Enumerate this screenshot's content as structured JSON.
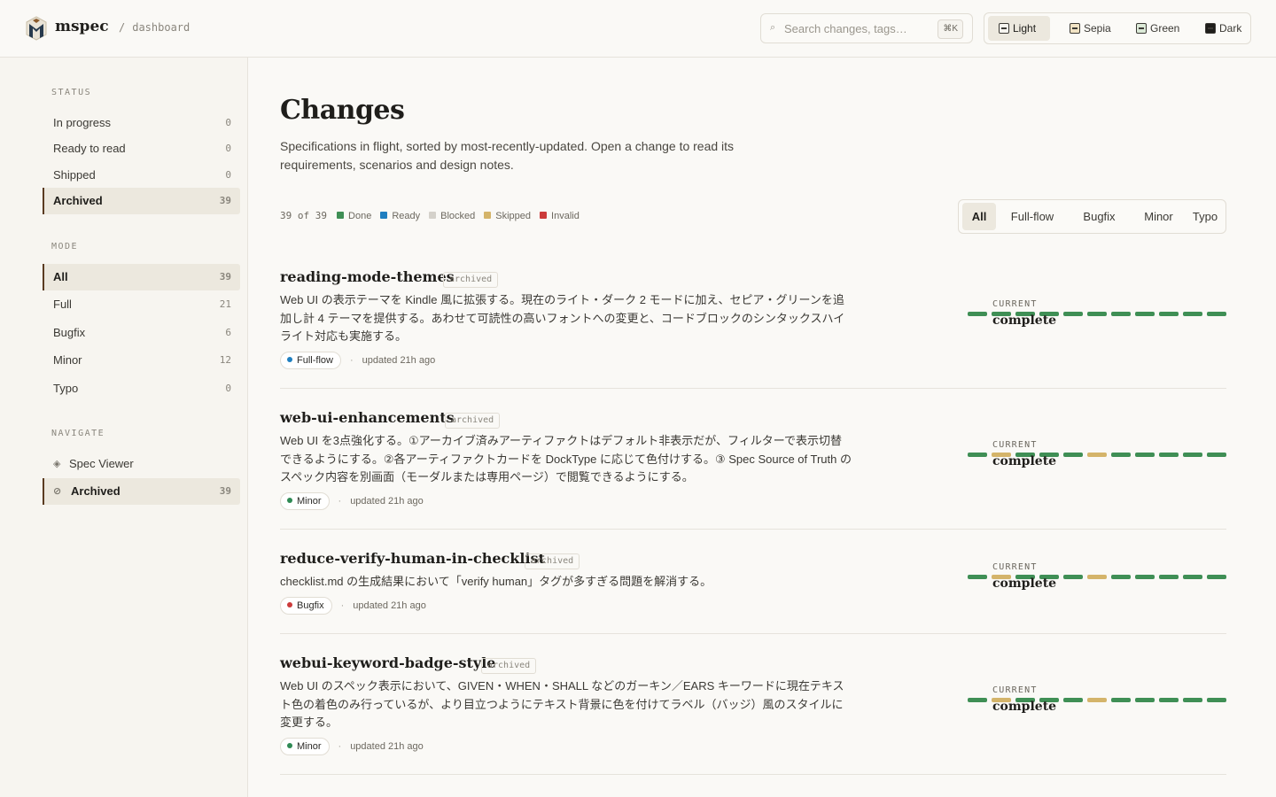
{
  "header": {
    "brand": "mspec",
    "crumb_sep": "/",
    "crumb": "dashboard",
    "search_placeholder": "Search changes, tags…",
    "search_shortcut": "⌘K",
    "themes": [
      {
        "label": "Light",
        "swatch": "#f6f4ef",
        "active": true
      },
      {
        "label": "Sepia",
        "swatch": "#f1e3c4",
        "active": false
      },
      {
        "label": "Green",
        "swatch": "#dbe9d7",
        "active": false
      },
      {
        "label": "Dark",
        "swatch": "#1f1e1b",
        "active": false
      }
    ]
  },
  "sidebar": {
    "status_title": "STATUS",
    "status": [
      {
        "label": "In progress",
        "count": "0",
        "active": false
      },
      {
        "label": "Ready to read",
        "count": "0",
        "active": false
      },
      {
        "label": "Shipped",
        "count": "0",
        "active": false
      },
      {
        "label": "Archived",
        "count": "39",
        "active": true
      }
    ],
    "mode_title": "MODE",
    "mode": [
      {
        "label": "All",
        "count": "39",
        "active": true
      },
      {
        "label": "Full",
        "count": "21",
        "active": false
      },
      {
        "label": "Bugfix",
        "count": "6",
        "active": false
      },
      {
        "label": "Minor",
        "count": "12",
        "active": false
      },
      {
        "label": "Typo",
        "count": "0",
        "active": false
      }
    ],
    "navigate_title": "NAVIGATE",
    "navigate": [
      {
        "label": "Spec Viewer",
        "icon": "◈",
        "icon_name": "diamond-icon",
        "count": "",
        "active": false
      },
      {
        "label": "Archived",
        "icon": "⊘",
        "icon_name": "archive-icon",
        "count": "39",
        "active": true
      }
    ]
  },
  "main": {
    "title": "Changes",
    "description": "Specifications in flight, sorted by most-recently-updated. Open a change to read its requirements, scenarios and design notes.",
    "count": "39 of 39",
    "legend": [
      {
        "label": "Done",
        "color": "#3f8f55"
      },
      {
        "label": "Ready",
        "color": "#1f7fc0"
      },
      {
        "label": "Blocked",
        "color": "#d4d1ca"
      },
      {
        "label": "Skipped",
        "color": "#d4b46a"
      },
      {
        "label": "Invalid",
        "color": "#cc3b3b"
      }
    ],
    "filters": [
      {
        "label": "All",
        "active": true
      },
      {
        "label": "Full-flow",
        "active": false
      },
      {
        "label": "Bugfix",
        "active": false
      },
      {
        "label": "Minor",
        "active": false
      },
      {
        "label": "Typo",
        "active": false
      }
    ],
    "changes": [
      {
        "name": "reading-mode-themes",
        "badge": "archived",
        "description": "Web UI の表示テーマを Kindle 風に拡張する。現在のライト・ダーク 2 モードに加え、セピア・グリーンを追加し計 4 テーマを提供する。あわせて可読性の高いフォントへの変更と、コードブロックのシンタックスハイライト対応も実施する。",
        "type": "Full-flow",
        "type_color": "#1f7fc0",
        "updated": "updated 21h ago",
        "progress_label": "CURRENT",
        "progress_state": "complete",
        "segments": [
          "done",
          "done",
          "done",
          "done",
          "done",
          "done",
          "done",
          "done",
          "done",
          "done",
          "done"
        ]
      },
      {
        "name": "web-ui-enhancements",
        "badge": "archived",
        "description": "Web UI を3点強化する。①アーカイブ済みアーティファクトはデフォルト非表示だが、フィルターで表示切替できるようにする。②各アーティファクトカードを DockType に応じて色付けする。③ Spec Source of Truth のスペック内容を別画面（モーダルまたは専用ページ）で閲覧できるようにする。",
        "type": "Minor",
        "type_color": "#2f8a54",
        "updated": "updated 21h ago",
        "progress_label": "CURRENT",
        "progress_state": "complete",
        "segments": [
          "done",
          "skipped",
          "done",
          "done",
          "done",
          "skipped",
          "done",
          "done",
          "done",
          "done",
          "done"
        ]
      },
      {
        "name": "reduce-verify-human-in-checklist",
        "badge": "archived",
        "description": "checklist.md の生成結果において「verify human」タグが多すぎる問題を解消する。",
        "type": "Bugfix",
        "type_color": "#cc3b3b",
        "updated": "updated 21h ago",
        "progress_label": "CURRENT",
        "progress_state": "complete",
        "segments": [
          "done",
          "skipped",
          "done",
          "done",
          "done",
          "skipped",
          "done",
          "done",
          "done",
          "done",
          "done"
        ]
      },
      {
        "name": "webui-keyword-badge-style",
        "badge": "archived",
        "description": "Web UI のスペック表示において、GIVEN・WHEN・SHALL などのガーキン／EARS キーワードに現在テキスト色の着色のみ行っているが、より目立つようにテキスト背景に色を付けてラベル（バッジ）風のスタイルに変更する。",
        "type": "Minor",
        "type_color": "#2f8a54",
        "updated": "updated 21h ago",
        "progress_label": "CURRENT",
        "progress_state": "complete",
        "segments": [
          "done",
          "skipped",
          "done",
          "done",
          "done",
          "skipped",
          "done",
          "done",
          "done",
          "done",
          "done"
        ]
      }
    ]
  },
  "colors": {
    "done": "#3f8f55",
    "skipped": "#d4b46a",
    "accent": "#5a3b21"
  }
}
